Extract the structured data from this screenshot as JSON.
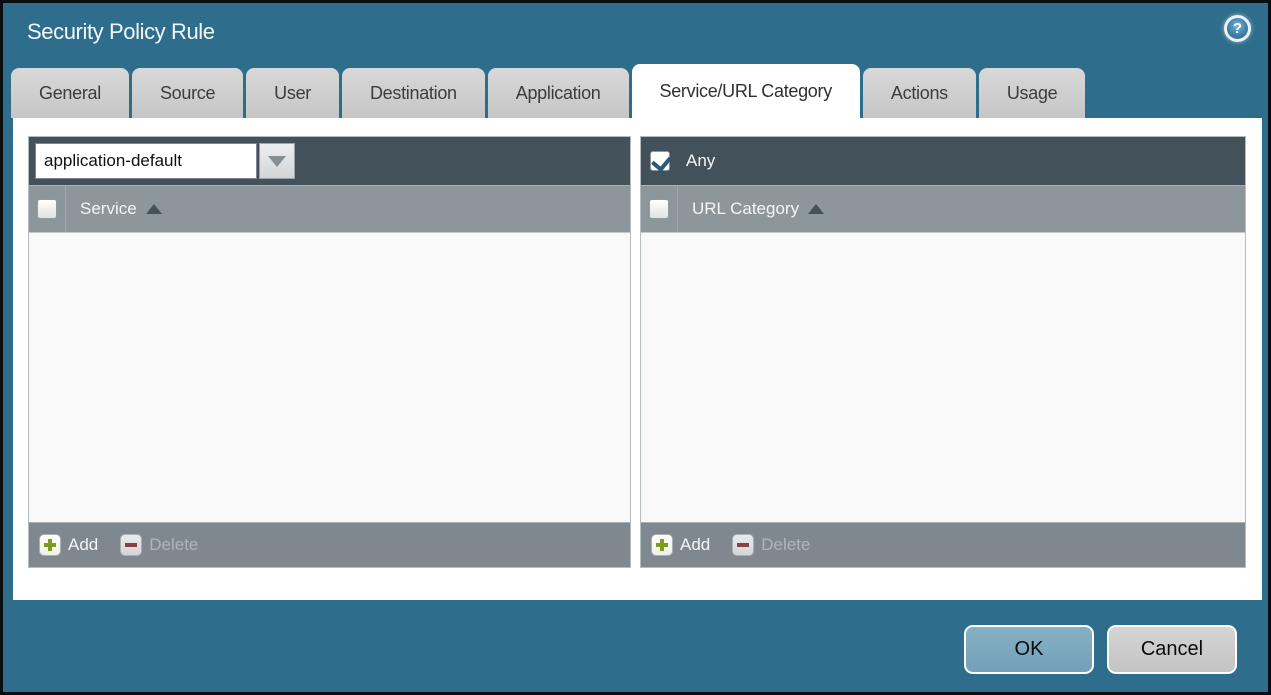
{
  "dialog": {
    "title": "Security Policy Rule",
    "help_icon": "?",
    "ok_label": "OK",
    "cancel_label": "Cancel"
  },
  "tabs": [
    {
      "label": "General",
      "active": false
    },
    {
      "label": "Source",
      "active": false
    },
    {
      "label": "User",
      "active": false
    },
    {
      "label": "Destination",
      "active": false
    },
    {
      "label": "Application",
      "active": false
    },
    {
      "label": "Service/URL Category",
      "active": true
    },
    {
      "label": "Actions",
      "active": false
    },
    {
      "label": "Usage",
      "active": false
    }
  ],
  "service_panel": {
    "dropdown_value": "application-default",
    "column_header": "Service",
    "sort_order": "ascending",
    "rows": [],
    "header_checkbox_checked": false,
    "add_label": "Add",
    "delete_label": "Delete",
    "delete_disabled": true
  },
  "url_category_panel": {
    "any_label": "Any",
    "any_checked": true,
    "column_header": "URL Category",
    "sort_order": "ascending",
    "rows": [],
    "header_checkbox_checked": false,
    "add_label": "Add",
    "delete_label": "Delete",
    "delete_disabled": true
  },
  "colors": {
    "dialog_background": "#2f6d8c",
    "panel_toolbar": "#42515a",
    "panel_header": "#8c969b",
    "panel_footer": "#7e888e",
    "tab_inactive": "#cccccc",
    "tab_active": "#ffffff",
    "ok_button": "#7ca9bf",
    "cancel_button": "#c9c9c9",
    "add_plus": "#7e9c1e",
    "delete_minus": "#8b4044",
    "checkmark": "#2b5876"
  }
}
